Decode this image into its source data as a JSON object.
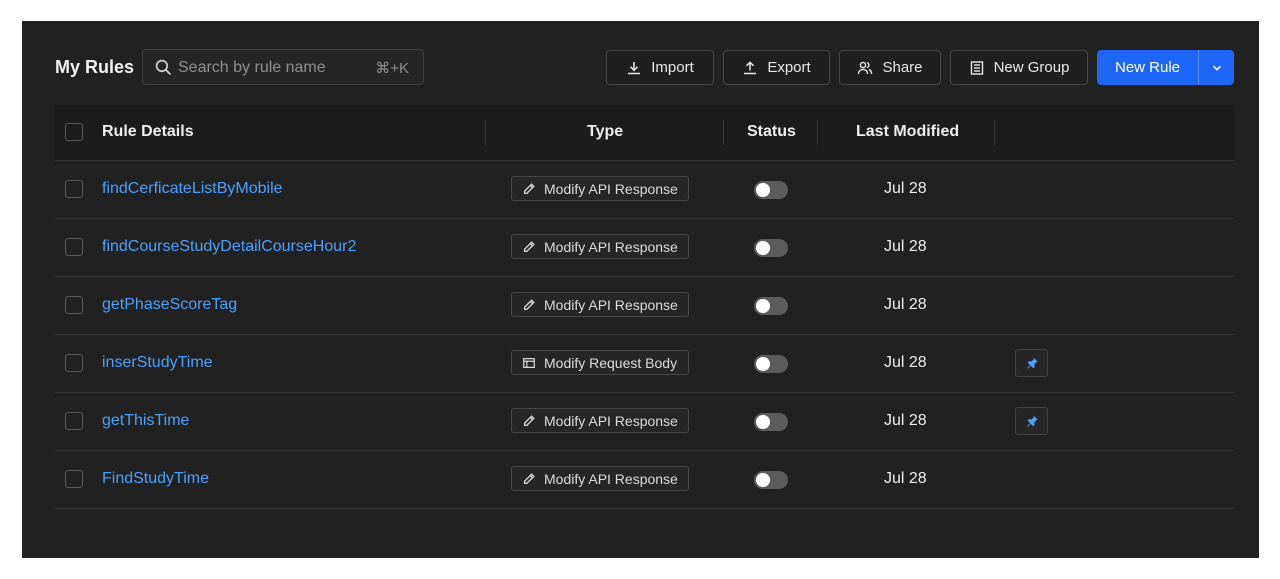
{
  "header": {
    "title": "My Rules",
    "search": {
      "placeholder": "Search by rule name",
      "shortcut": "⌘+K",
      "icon": "search-icon"
    },
    "buttons": {
      "import": "Import",
      "export": "Export",
      "share": "Share",
      "new_group": "New Group",
      "new_rule": "New Rule"
    },
    "colors": {
      "accent": "#1e66f5",
      "link": "#4aa2ff",
      "background": "#212121"
    }
  },
  "table": {
    "columns": {
      "details": "Rule Details",
      "type": "Type",
      "status": "Status",
      "modified": "Last Modified"
    },
    "rows": [
      {
        "name": "findCerficateListByMobile",
        "type": "Modify API Response",
        "type_icon": "pencil-icon",
        "enabled": false,
        "modified": "Jul 28",
        "pinned": false
      },
      {
        "name": "findCourseStudyDetailCourseHour2",
        "type": "Modify API Response",
        "type_icon": "pencil-icon",
        "enabled": false,
        "modified": "Jul 28",
        "pinned": false
      },
      {
        "name": "getPhaseScoreTag",
        "type": "Modify API Response",
        "type_icon": "pencil-icon",
        "enabled": false,
        "modified": "Jul 28",
        "pinned": false
      },
      {
        "name": "inserStudyTime",
        "type": "Modify Request Body",
        "type_icon": "request-body-icon",
        "enabled": false,
        "modified": "Jul 28",
        "pinned": true
      },
      {
        "name": "getThisTime",
        "type": "Modify API Response",
        "type_icon": "pencil-icon",
        "enabled": false,
        "modified": "Jul 28",
        "pinned": true
      },
      {
        "name": "FindStudyTime",
        "type": "Modify API Response",
        "type_icon": "pencil-icon",
        "enabled": false,
        "modified": "Jul 28",
        "pinned": false
      }
    ]
  }
}
